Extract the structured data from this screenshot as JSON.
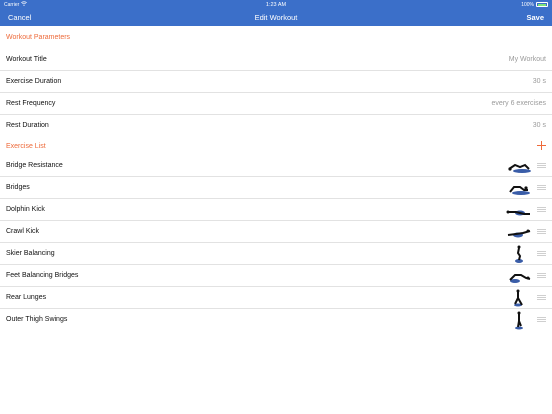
{
  "status": {
    "carrier": "Carrier",
    "time": "1:23 AM",
    "battery": "100%"
  },
  "nav": {
    "cancel": "Cancel",
    "title": "Edit Workout",
    "save": "Save"
  },
  "parameters_header": "Workout Parameters",
  "params": [
    {
      "label": "Workout Title",
      "value": "My Workout"
    },
    {
      "label": "Exercise Duration",
      "value": "30 s"
    },
    {
      "label": "Rest Frequency",
      "value": "every 6 exercises"
    },
    {
      "label": "Rest Duration",
      "value": "30 s"
    }
  ],
  "exercise_header": "Exercise List",
  "exercises": [
    {
      "label": "Bridge Resistance",
      "icon": "bridge-resistance-thumbnail"
    },
    {
      "label": "Bridges",
      "icon": "bridges-thumbnail"
    },
    {
      "label": "Dolphin Kick",
      "icon": "dolphin-kick-thumbnail"
    },
    {
      "label": "Crawl Kick",
      "icon": "crawl-kick-thumbnail"
    },
    {
      "label": "Skier Balancing",
      "icon": "skier-balancing-thumbnail"
    },
    {
      "label": "Feet Balancing Bridges",
      "icon": "feet-balancing-bridges-thumbnail"
    },
    {
      "label": "Rear Lunges",
      "icon": "rear-lunges-thumbnail"
    },
    {
      "label": "Outer Thigh Swings",
      "icon": "outer-thigh-swings-thumbnail"
    }
  ],
  "colors": {
    "nav_bar": "#3b6fc9",
    "section_header": "#ee6a3a",
    "value_text": "#9a9a9a"
  }
}
